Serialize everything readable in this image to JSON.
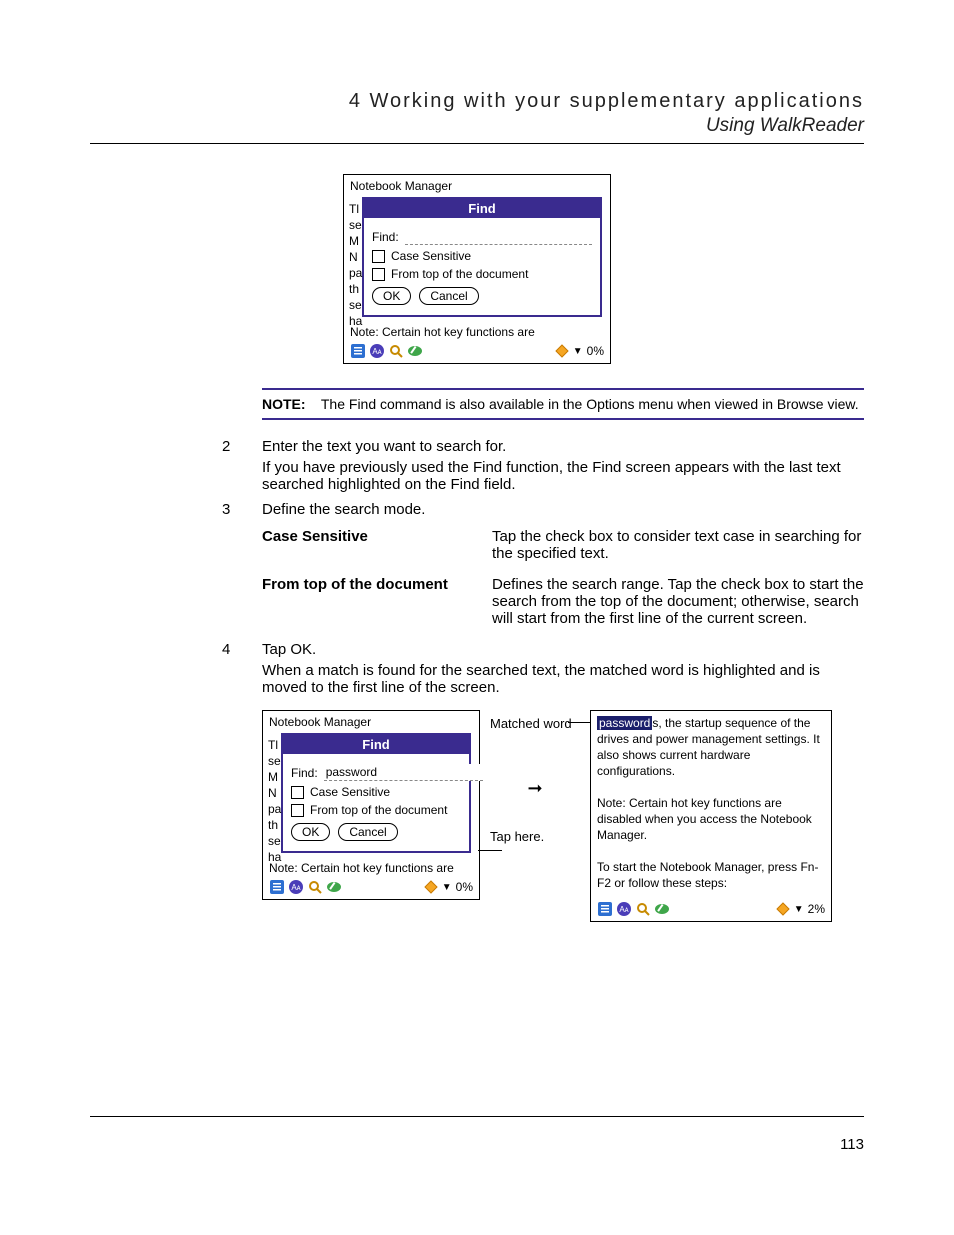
{
  "header": {
    "chapter_title": "4 Working with your supplementary applications",
    "subtitle": "Using WalkReader"
  },
  "page_number": "113",
  "fig_top": {
    "app_title": "Notebook Manager",
    "bg_letters": "Tl\nse\nM\nN\npa\nth\nse\nha",
    "find_title": "Find",
    "find_label": "Find:",
    "find_value": "",
    "case_sensitive_label": "Case Sensitive",
    "from_top_label": "From top of the document",
    "ok_label": "OK",
    "cancel_label": "Cancel",
    "note_line": "Note: Certain hot key functions are",
    "percent": "0%"
  },
  "note_box": {
    "prefix": "NOTE:",
    "text": "The Find command is also available in the Options menu when viewed in Browse view."
  },
  "steps": {
    "s2_num": "2",
    "s2_text": "Enter the text you want to search for.",
    "s2_sub": "If you have previously used the Find function, the Find screen appears with the last text searched highlighted on the Find field.",
    "s3_num": "3",
    "s3_text": "Define the search mode.",
    "s4_num": "4",
    "s4_text": "Tap OK.",
    "s4_sub": "When a match is found for the searched text, the matched word is highlighted and is moved to the first line of the screen."
  },
  "definitions": {
    "case_term": "Case Sensitive",
    "case_desc": "Tap the check box to consider text case in searching for the specified text.",
    "top_term": "From top of the document",
    "top_desc": "Defines the search range. Tap the check box to start the search from the top of the document; otherwise, search will start from the first line of the current screen."
  },
  "fig_left": {
    "app_title": "Notebook Manager",
    "bg_letters": "Tl\nse\nM\nN\npa\nth\nse\nha",
    "find_title": "Find",
    "find_label": "Find:",
    "find_value": "password",
    "case_sensitive_label": "Case Sensitive",
    "from_top_label": "From top of the document",
    "ok_label": "OK",
    "cancel_label": "Cancel",
    "note_line": "Note: Certain hot key functions are",
    "percent": "0%"
  },
  "mid": {
    "matched_word_label": "Matched word",
    "tap_here_label": "Tap here."
  },
  "fig_right": {
    "match_word": "password",
    "para1_suffix": "s, the startup sequence of the drives and power management settings. It also shows current hardware configurations.",
    "para2": "Note: Certain hot key functions are disabled when you access the Notebook Manager.",
    "para3": "To start the Notebook Manager, press Fn-F2 or follow these steps:",
    "percent": "2%"
  }
}
